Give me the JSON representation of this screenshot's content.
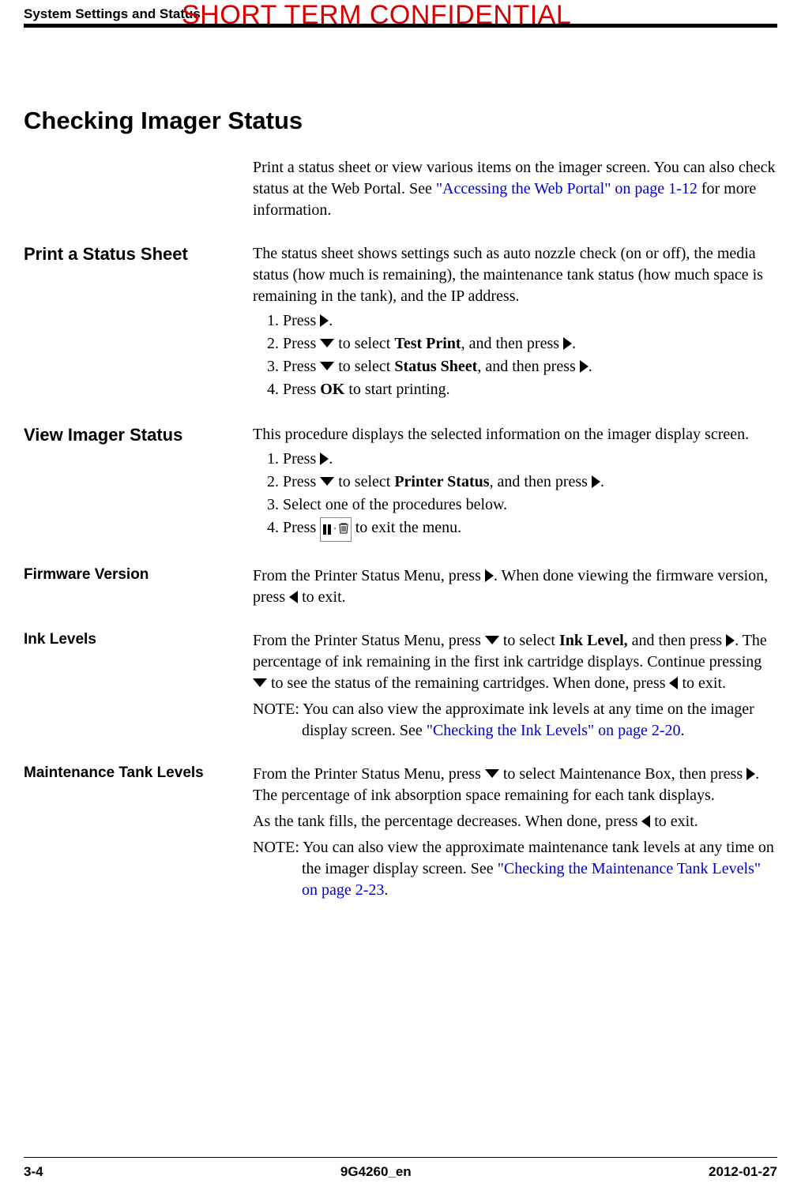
{
  "header": {
    "section_label": "System Settings and Status",
    "watermark": "SHORT TERM CONFIDENTIAL"
  },
  "main_heading": "Checking Imager Status",
  "intro": {
    "text_before_link": "Print a status sheet or view various items on the imager screen. You can also check status at the Web Portal. See ",
    "link_text": "\"Accessing the Web Portal\" on page 1-12",
    "text_after_link": " for more information."
  },
  "print_status": {
    "heading": "Print a Status Sheet",
    "para": "The status sheet shows settings such as auto nozzle check (on or off), the media status (how much is remaining), the maintenance tank status (how much space is remaining in the tank), and the IP address.",
    "steps": {
      "s1_a": "Press ",
      "s1_b": ".",
      "s2_a": "Press ",
      "s2_b": " to select ",
      "s2_bold": "Test Print",
      "s2_c": ", and then press ",
      "s2_d": ".",
      "s3_a": "Press ",
      "s3_b": " to select ",
      "s3_bold": "Status Sheet",
      "s3_c": ", and then press ",
      "s3_d": ".",
      "s4_a": "Press ",
      "s4_bold": "OK",
      "s4_b": " to start printing."
    }
  },
  "view_status": {
    "heading": "View Imager Status",
    "para": "This procedure displays the selected information on the imager display screen.",
    "steps": {
      "s1_a": "Press ",
      "s1_b": ".",
      "s2_a": "Press ",
      "s2_b": " to select ",
      "s2_bold": "Printer Status",
      "s2_c": ", and then press ",
      "s2_d": ".",
      "s3": "Select one of the procedures below.",
      "s4_a": "Press ",
      "s4_b": " to exit the menu."
    }
  },
  "firmware": {
    "heading": "Firmware Version",
    "a": "From the Printer Status Menu, press ",
    "b": ". When done viewing the firmware version, press ",
    "c": " to exit."
  },
  "ink": {
    "heading": "Ink Levels",
    "a": "From the Printer Status Menu, press ",
    "b": " to select ",
    "bold": "Ink Level,",
    "c": " and then press ",
    "d": ". The percentage of ink remaining in the first ink cartridge displays. Continue pressing ",
    "e": " to see the status of the remaining cartridges. When done, press ",
    "f": " to exit.",
    "note_a": "NOTE: You can also view the approximate ink levels at any time on the imager display screen. See ",
    "note_link": "\"Checking the Ink Levels\" on page 2-20",
    "note_b": "."
  },
  "maint": {
    "heading": "Maintenance Tank Levels",
    "a": "From the Printer Status Menu, press ",
    "b": " to select Maintenance Box, then press ",
    "c": ". The percentage of ink absorption space remaining for each tank displays.",
    "d": "As the tank fills, the percentage decreases. When done, press ",
    "e": " to exit.",
    "note_a": "NOTE: You can also view the approximate maintenance tank levels at any time on the imager display screen. See ",
    "note_link": "\"Checking the Maintenance Tank Levels\" on page 2-23",
    "note_b": "."
  },
  "footer": {
    "page": "3-4",
    "doc_id": "9G4260_en",
    "date": "2012-01-27"
  }
}
